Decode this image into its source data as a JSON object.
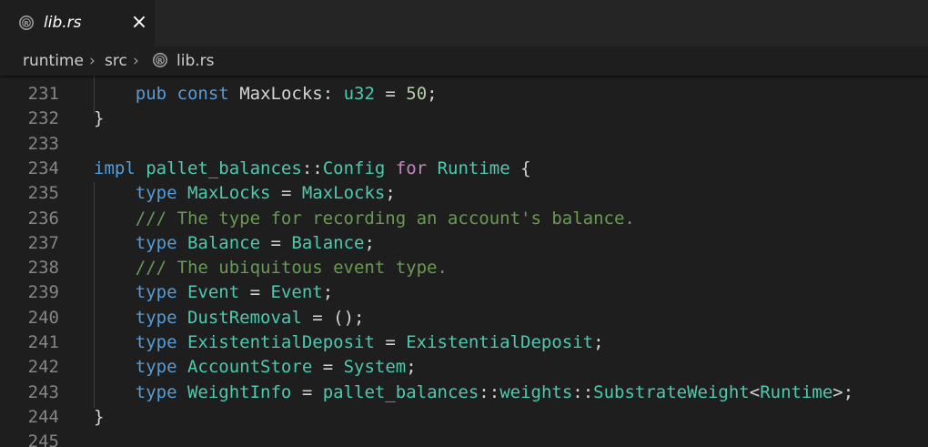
{
  "tab": {
    "label": "lib.rs",
    "icon": "rust-file-icon",
    "close": "×"
  },
  "breadcrumb": {
    "items": [
      "runtime",
      "src",
      "lib.rs"
    ],
    "separator": "›"
  },
  "colors": {
    "keyword": "#569cd6",
    "type": "#4ec9b0",
    "identifier": "#9cdcfe",
    "number": "#b5cea8",
    "comment": "#6a9955",
    "control": "#c586c0",
    "text": "#d4d4d4"
  },
  "editor": {
    "lines": [
      {
        "n": "231",
        "tokens": [
          [
            "    ",
            ""
          ],
          [
            "pub",
            "kw"
          ],
          [
            " ",
            ""
          ],
          [
            "const",
            "kw"
          ],
          [
            " MaxLocks: ",
            ""
          ],
          [
            "u32",
            "ty"
          ],
          [
            " = ",
            ""
          ],
          [
            "50",
            "num"
          ],
          [
            ";",
            ""
          ]
        ]
      },
      {
        "n": "232",
        "tokens": [
          [
            "}",
            ""
          ]
        ]
      },
      {
        "n": "233",
        "tokens": []
      },
      {
        "n": "234",
        "tokens": [
          [
            "impl",
            "kw"
          ],
          [
            " ",
            ""
          ],
          [
            "pallet_balances",
            "ty"
          ],
          [
            "::",
            ""
          ],
          [
            "Config",
            "ty"
          ],
          [
            " ",
            ""
          ],
          [
            "for",
            "kw2"
          ],
          [
            " ",
            ""
          ],
          [
            "Runtime",
            "ty"
          ],
          [
            " {",
            ""
          ]
        ]
      },
      {
        "n": "235",
        "tokens": [
          [
            "    ",
            ""
          ],
          [
            "type",
            "kw"
          ],
          [
            " ",
            ""
          ],
          [
            "MaxLocks",
            "ty"
          ],
          [
            " = ",
            ""
          ],
          [
            "MaxLocks",
            "ty"
          ],
          [
            ";",
            ""
          ]
        ]
      },
      {
        "n": "236",
        "tokens": [
          [
            "    ",
            ""
          ],
          [
            "/// The type for recording an account's balance.",
            "cm"
          ]
        ]
      },
      {
        "n": "237",
        "tokens": [
          [
            "    ",
            ""
          ],
          [
            "type",
            "kw"
          ],
          [
            " ",
            ""
          ],
          [
            "Balance",
            "ty"
          ],
          [
            " = ",
            ""
          ],
          [
            "Balance",
            "ty"
          ],
          [
            ";",
            ""
          ]
        ]
      },
      {
        "n": "238",
        "tokens": [
          [
            "    ",
            ""
          ],
          [
            "/// The ubiquitous event type.",
            "cm"
          ]
        ]
      },
      {
        "n": "239",
        "tokens": [
          [
            "    ",
            ""
          ],
          [
            "type",
            "kw"
          ],
          [
            " ",
            ""
          ],
          [
            "Event",
            "ty"
          ],
          [
            " = ",
            ""
          ],
          [
            "Event",
            "ty"
          ],
          [
            ";",
            ""
          ]
        ]
      },
      {
        "n": "240",
        "tokens": [
          [
            "    ",
            ""
          ],
          [
            "type",
            "kw"
          ],
          [
            " ",
            ""
          ],
          [
            "DustRemoval",
            "ty"
          ],
          [
            " = ();",
            ""
          ]
        ]
      },
      {
        "n": "241",
        "tokens": [
          [
            "    ",
            ""
          ],
          [
            "type",
            "kw"
          ],
          [
            " ",
            ""
          ],
          [
            "ExistentialDeposit",
            "ty"
          ],
          [
            " = ",
            ""
          ],
          [
            "ExistentialDeposit",
            "ty"
          ],
          [
            ";",
            ""
          ]
        ]
      },
      {
        "n": "242",
        "tokens": [
          [
            "    ",
            ""
          ],
          [
            "type",
            "kw"
          ],
          [
            " ",
            ""
          ],
          [
            "AccountStore",
            "ty"
          ],
          [
            " = ",
            ""
          ],
          [
            "System",
            "ty"
          ],
          [
            ";",
            ""
          ]
        ]
      },
      {
        "n": "243",
        "tokens": [
          [
            "    ",
            ""
          ],
          [
            "type",
            "kw"
          ],
          [
            " ",
            ""
          ],
          [
            "WeightInfo",
            "ty"
          ],
          [
            " = ",
            ""
          ],
          [
            "pallet_balances",
            "ty"
          ],
          [
            "::",
            ""
          ],
          [
            "weights",
            "ty"
          ],
          [
            "::",
            ""
          ],
          [
            "SubstrateWeight",
            "ty"
          ],
          [
            "<",
            ""
          ],
          [
            "Runtime",
            "ty"
          ],
          [
            ">;",
            ""
          ]
        ]
      },
      {
        "n": "244",
        "tokens": [
          [
            "}",
            ""
          ]
        ]
      },
      {
        "n": "245",
        "tokens": []
      }
    ]
  }
}
